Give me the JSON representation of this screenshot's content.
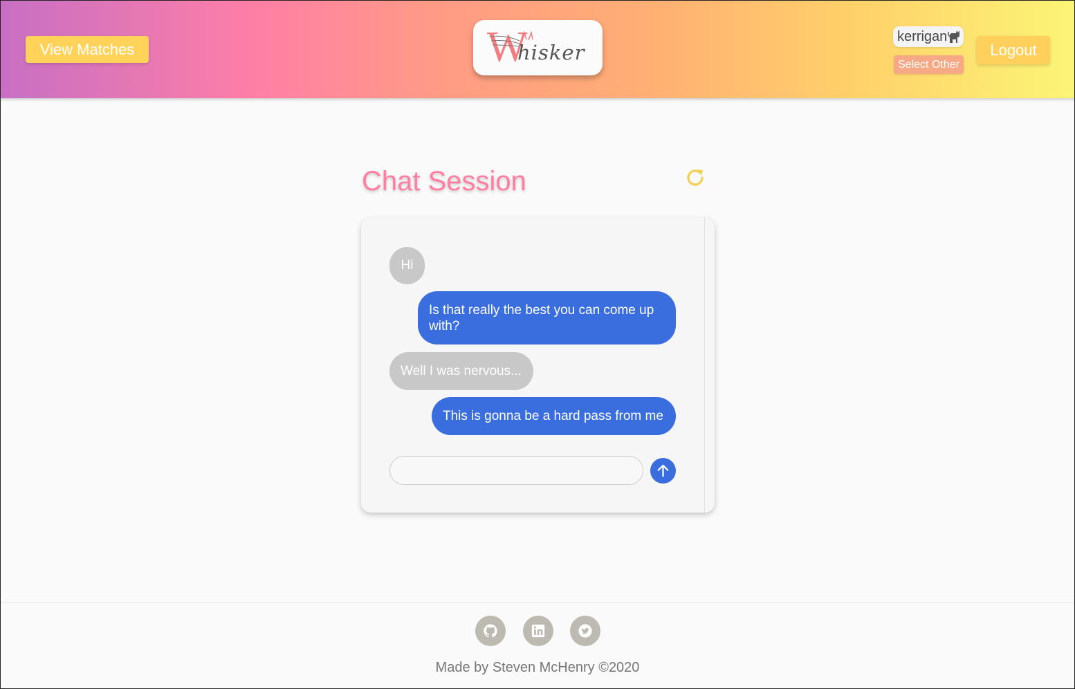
{
  "header": {
    "view_matches_label": "View Matches",
    "logout_label": "Logout",
    "logo": {
      "initial": "W",
      "rest": "hisker"
    },
    "user": {
      "name": "kerrigan",
      "select_other_label": "Select Other"
    }
  },
  "chat": {
    "title": "Chat Session",
    "messages": [
      {
        "direction": "in",
        "text": "Hi"
      },
      {
        "direction": "out",
        "text": "Is that really the best you can come up with?"
      },
      {
        "direction": "in",
        "text": "Well I was nervous..."
      },
      {
        "direction": "out",
        "text": "This is gonna be a hard pass from me"
      }
    ],
    "input": {
      "value": "",
      "placeholder": ""
    }
  },
  "footer": {
    "social": [
      "github-icon",
      "linkedin-icon",
      "twitter-icon"
    ],
    "credit": "Made by Steven McHenry ©2020"
  },
  "colors": {
    "title_pink": "#ff7fa2",
    "button_yellow": "#ffd35a",
    "select_other_orange": "#f7a985",
    "outgoing_blue": "#3a6dde",
    "incoming_gray": "#c8c8c8",
    "refresh_yellow": "#f2cf55"
  }
}
